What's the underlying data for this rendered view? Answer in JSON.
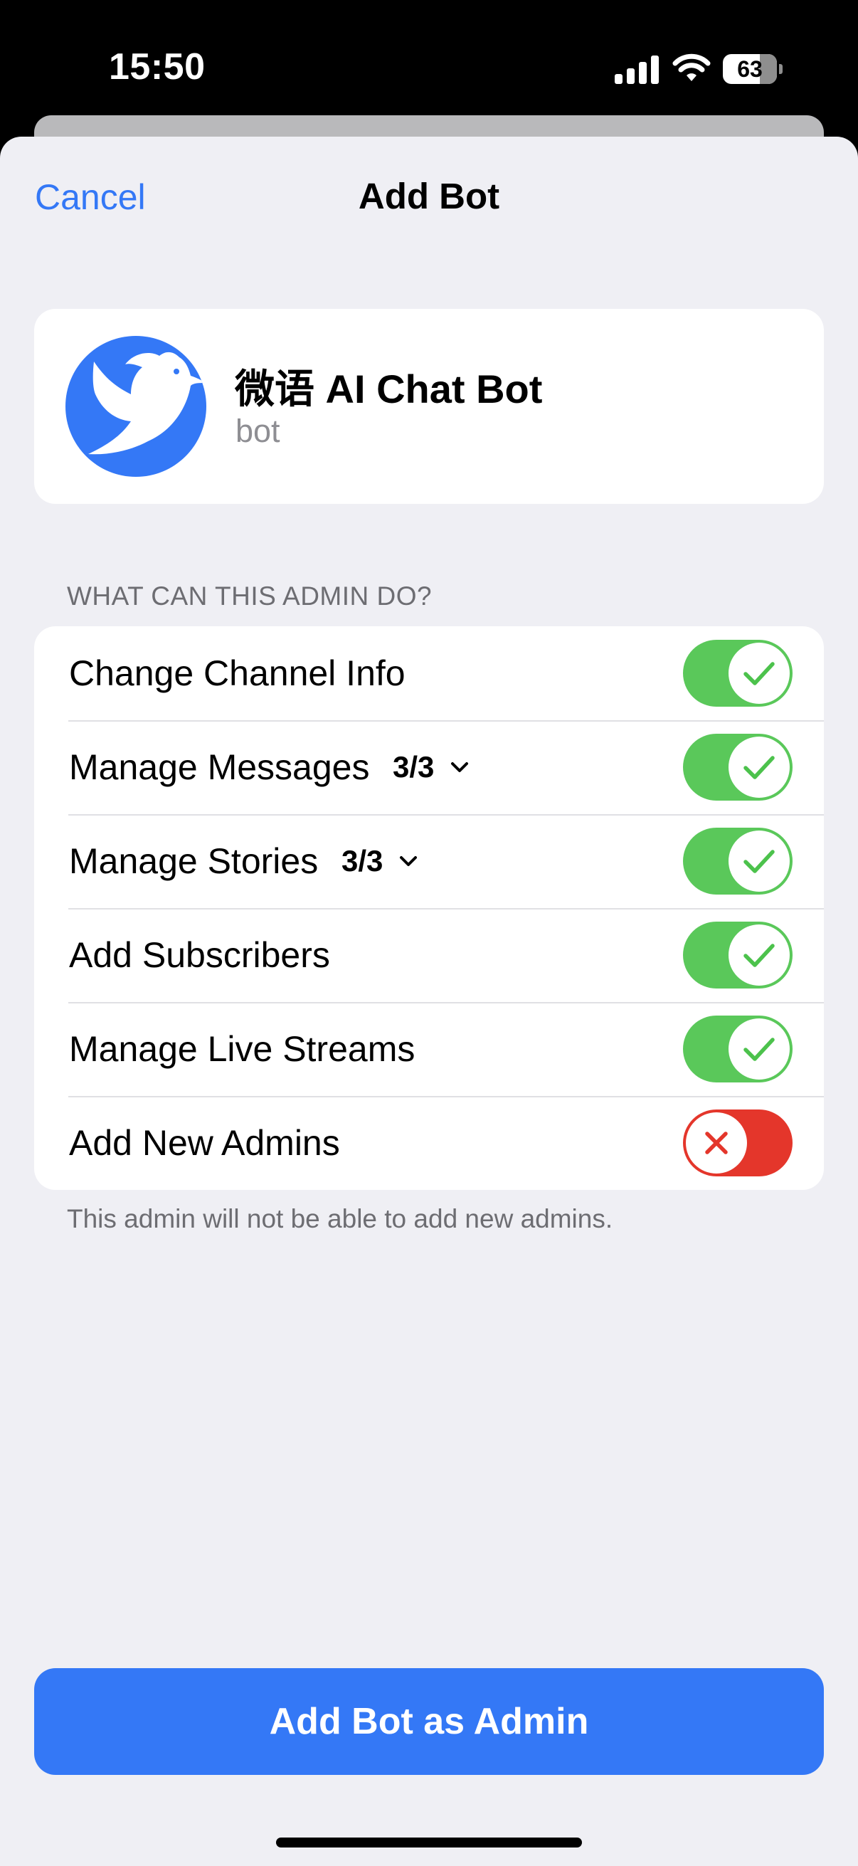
{
  "status_bar": {
    "time": "15:50",
    "battery_level": "63",
    "icons": [
      "signal-icon",
      "wifi-icon",
      "battery-icon"
    ]
  },
  "nav": {
    "cancel_label": "Cancel",
    "title": "Add Bot"
  },
  "bot": {
    "name": "微语 AI Chat Bot",
    "subtitle": "bot",
    "avatar_icon": "dove-icon",
    "avatar_color": "#3478f6"
  },
  "permissions": {
    "header": "WHAT CAN THIS ADMIN DO?",
    "items": [
      {
        "label": "Change Channel Info",
        "enabled": true
      },
      {
        "label": "Manage Messages",
        "count": "3/3",
        "enabled": true
      },
      {
        "label": "Manage Stories",
        "count": "3/3",
        "enabled": true
      },
      {
        "label": "Add Subscribers",
        "enabled": true
      },
      {
        "label": "Manage Live Streams",
        "enabled": true
      },
      {
        "label": "Add New Admins",
        "enabled": false
      }
    ],
    "footnote": "This admin will not be able to add new admins."
  },
  "primary_button": {
    "label": "Add Bot as Admin"
  },
  "colors": {
    "accent": "#3478f6",
    "toggle_on": "#5ac85a",
    "toggle_off": "#e4362b",
    "background": "#efeff4"
  }
}
